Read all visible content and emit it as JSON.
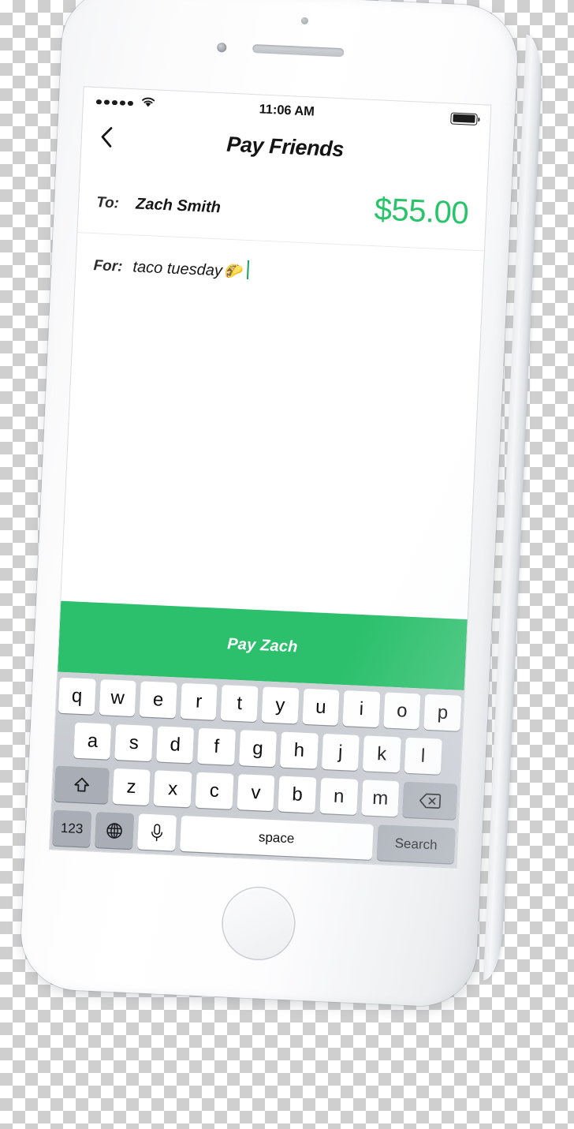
{
  "device": {
    "type": "white-smartphone",
    "hardware": {
      "speaker": "speaker-grille",
      "front_camera": "front-camera",
      "proximity_sensor": "proximity-sensor",
      "home_button": "home-button"
    }
  },
  "status_bar": {
    "signal_dots": 5,
    "wifi_icon": "wifi-icon",
    "time": "11:06 AM",
    "battery_icon": "battery-full-icon",
    "battery_level_pct": 100
  },
  "nav": {
    "back_icon": "chevron-left-icon",
    "title": "Pay Friends"
  },
  "form": {
    "to_label": "To:",
    "to_value": "Zach Smith",
    "amount": "$55.00",
    "amount_color": "#27c46a",
    "for_label": "For:",
    "for_value": "taco tuesday",
    "for_emoji": "🌮",
    "caret_color": "#1aa35c"
  },
  "pay_button": {
    "label": "Pay Zach",
    "background": "#2cc06c",
    "text_color": "#ffffff"
  },
  "keyboard": {
    "row1": [
      "q",
      "w",
      "e",
      "r",
      "t",
      "y",
      "u",
      "i",
      "o",
      "p"
    ],
    "row2": [
      "a",
      "s",
      "d",
      "f",
      "g",
      "h",
      "j",
      "k",
      "l"
    ],
    "row3_letters": [
      "z",
      "x",
      "c",
      "v",
      "b",
      "n",
      "m"
    ],
    "shift_icon": "shift-up-arrow-icon",
    "backspace_icon": "backspace-delete-icon",
    "numbers_key": "123",
    "globe_icon": "globe-language-icon",
    "mic_icon": "microphone-icon",
    "space_key": "space",
    "return_key": "Search",
    "key_background": "#ffffff",
    "modifier_background": "#a9aeb6",
    "keyboard_background": "#c9ccd1"
  }
}
